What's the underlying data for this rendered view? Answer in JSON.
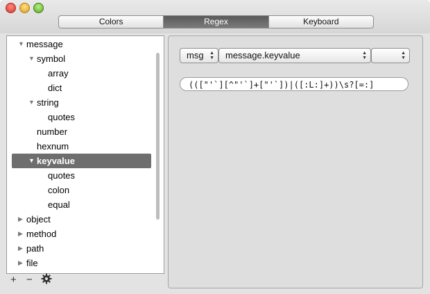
{
  "tabs": [
    {
      "label": "Colors"
    },
    {
      "label": "Regex"
    },
    {
      "label": "Keyboard"
    }
  ],
  "tree": [
    {
      "label": "message",
      "depth": 0,
      "expanded": true,
      "has_children": true
    },
    {
      "label": "symbol",
      "depth": 1,
      "expanded": true,
      "has_children": true
    },
    {
      "label": "array",
      "depth": 2,
      "has_children": false
    },
    {
      "label": "dict",
      "depth": 2,
      "has_children": false
    },
    {
      "label": "string",
      "depth": 1,
      "expanded": true,
      "has_children": true
    },
    {
      "label": "quotes",
      "depth": 2,
      "has_children": false
    },
    {
      "label": "number",
      "depth": 1,
      "has_children": false
    },
    {
      "label": "hexnum",
      "depth": 1,
      "has_children": false
    },
    {
      "label": "keyvalue",
      "depth": 1,
      "expanded": true,
      "has_children": true,
      "selected": true
    },
    {
      "label": "quotes",
      "depth": 2,
      "has_children": false
    },
    {
      "label": "colon",
      "depth": 2,
      "has_children": false
    },
    {
      "label": "equal",
      "depth": 2,
      "has_children": false
    },
    {
      "label": "object",
      "depth": 0,
      "expanded": false,
      "has_children": true
    },
    {
      "label": "method",
      "depth": 0,
      "expanded": false,
      "has_children": true
    },
    {
      "label": "path",
      "depth": 0,
      "expanded": false,
      "has_children": true
    },
    {
      "label": "file",
      "depth": 0,
      "expanded": false,
      "has_children": true
    }
  ],
  "bottom_bar": {
    "add_label": "+",
    "remove_label": "−",
    "gear_icon": "gear-icon"
  },
  "main": {
    "scope_popup": {
      "value": "msg"
    },
    "rule_popup": {
      "value": "message.keyvalue"
    },
    "extra_popup": {
      "value": ""
    },
    "regex_value": "(([\"'`][^\"'`]+[\"'`])|([:L:]+))\\s?[=:]"
  },
  "colors": {
    "selection": "#6e6e6e",
    "active_tab": "#5a5a5a"
  }
}
